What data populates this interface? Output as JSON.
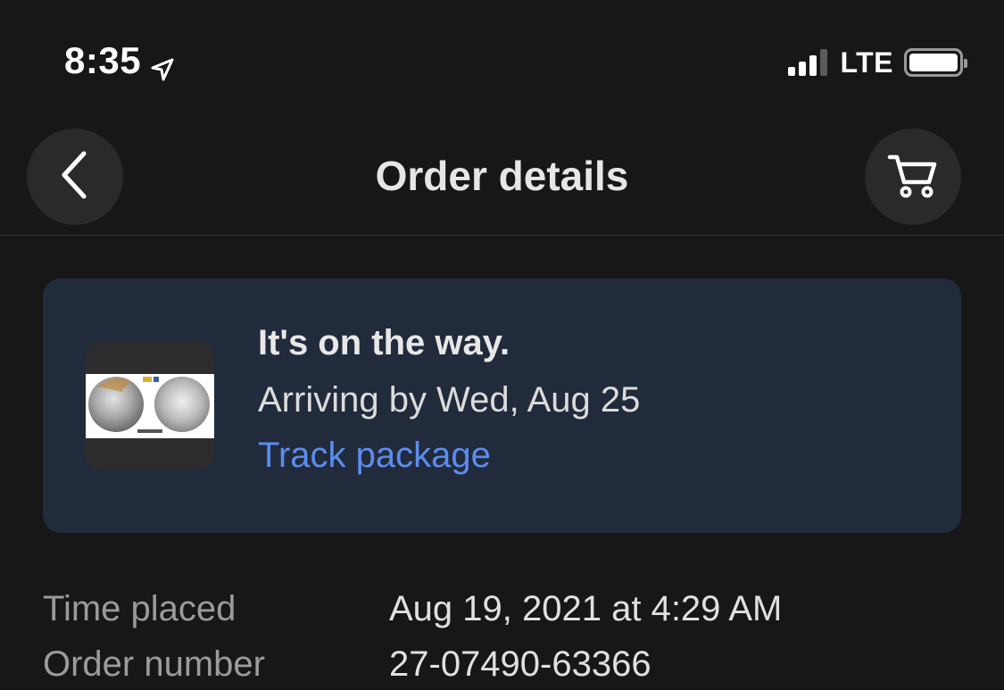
{
  "status": {
    "time": "8:35",
    "network": "LTE",
    "icons": [
      "location-arrow-icon",
      "signal-icon",
      "battery-icon"
    ]
  },
  "nav": {
    "title": "Order details",
    "back_icon": "chevron-left-icon",
    "cart_icon": "cart-icon"
  },
  "shipment": {
    "title": "It's on the way.",
    "subtitle": "Arriving by Wed, Aug 25",
    "link": "Track package"
  },
  "details": [
    {
      "label": "Time placed",
      "value": "Aug 19, 2021 at 4:29 AM"
    },
    {
      "label": "Order number",
      "value": "27-07490-63366"
    }
  ],
  "colors": {
    "background": "#171717",
    "card": "#222b3b",
    "link": "#5b8def",
    "button": "#2a2a2a"
  }
}
